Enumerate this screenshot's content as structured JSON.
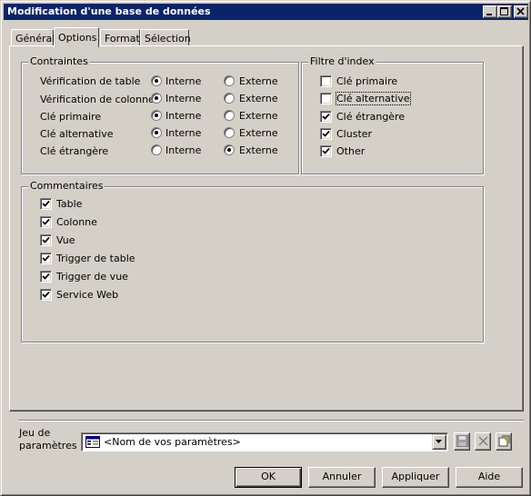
{
  "window": {
    "title": "Modification d'une base de données"
  },
  "tabs": [
    {
      "label": "Général",
      "active": false
    },
    {
      "label": "Options",
      "active": true
    },
    {
      "label": "Format",
      "active": false
    },
    {
      "label": "Sélection",
      "active": false
    }
  ],
  "contraintes": {
    "legend": "Contraintes",
    "option_interne": "Interne",
    "option_externe": "Externe",
    "rows": [
      {
        "label": "Vérification de table",
        "selected": "Interne"
      },
      {
        "label": "Vérification de colonne",
        "selected": "Interne"
      },
      {
        "label": "Clé primaire",
        "selected": "Interne"
      },
      {
        "label": "Clé alternative",
        "selected": "Interne"
      },
      {
        "label": "Clé étrangère",
        "selected": "Externe"
      }
    ]
  },
  "filtre_index": {
    "legend": "Filtre d'index",
    "items": [
      {
        "label": "Clé primaire",
        "checked": false
      },
      {
        "label": "Clé alternative",
        "checked": false
      },
      {
        "label": "Clé étrangère",
        "checked": true
      },
      {
        "label": "Cluster",
        "checked": true
      },
      {
        "label": "Other",
        "checked": true
      }
    ]
  },
  "commentaires": {
    "legend": "Commentaires",
    "items": [
      {
        "label": "Table",
        "checked": true
      },
      {
        "label": "Colonne",
        "checked": true
      },
      {
        "label": "Vue",
        "checked": true
      },
      {
        "label": "Trigger de table",
        "checked": true
      },
      {
        "label": "Trigger de vue",
        "checked": true
      },
      {
        "label": "Service Web",
        "checked": true
      }
    ]
  },
  "parameters": {
    "label_line1": "Jeu de",
    "label_line2": "paramètres :",
    "value": "<Nom de vos paramètres>",
    "icon": "parameter-set-icon"
  },
  "toolbar_icons": [
    "save-icon",
    "delete-icon",
    "properties-icon"
  ],
  "buttons": {
    "ok": "OK",
    "cancel": "Annuler",
    "apply": "Appliquer",
    "help": "Aide"
  },
  "colors": {
    "titlebar": "#0a246a",
    "face": "#d4d0c8"
  }
}
